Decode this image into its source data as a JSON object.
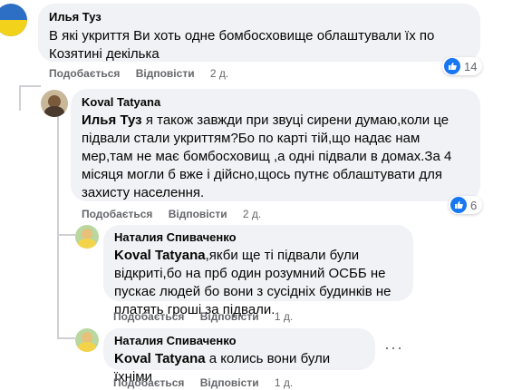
{
  "comments": [
    {
      "author": "Илья Туз",
      "mention": "",
      "text": "В які укриття Ви хоть одне бомбосховище облаштували їх по Козятині декілька",
      "like_label": "Подобається",
      "reply_label": "Відповісти",
      "time": "2 д.",
      "reactions": "14"
    },
    {
      "author": "Koval Tatyana",
      "mention": "Илья Туз",
      "text": "я також завжди при звуці сирени думаю,коли це підвали стали укриттям?Бо по карті тій,що надає нам мер,там не має бомбосховищ ,а одні підвали в домах.За 4 місяця могли б вже і дійсно,щось путнє облаштувати для захисту населення.",
      "like_label": "Подобається",
      "reply_label": "Відповісти",
      "time": "2 д.",
      "reactions": "6"
    },
    {
      "author": "Наталия Спиваченко",
      "mention": "Koval Tatyana",
      "text": ",якби ще ті підвали були відкриті,бо на прб один розумний ОСББ не пускає людей бо вони з сусідніх будинків не платять гроші за підвали.",
      "like_label": "Подобається",
      "reply_label": "Відповісти",
      "time": "1 д."
    },
    {
      "author": "Наталия Спиваченко",
      "mention": "Koval Tatyana",
      "text": "а колись вони були їхніми",
      "like_label": "Подобається",
      "reply_label": "Відповісти",
      "time": "1 д."
    }
  ],
  "colors": {
    "bubble": "#f0f2f5",
    "secondary_text": "#65676b",
    "like_blue": "#1877f2"
  },
  "icons": {
    "like": "thumbs-up-icon",
    "more": "more-options-icon"
  }
}
